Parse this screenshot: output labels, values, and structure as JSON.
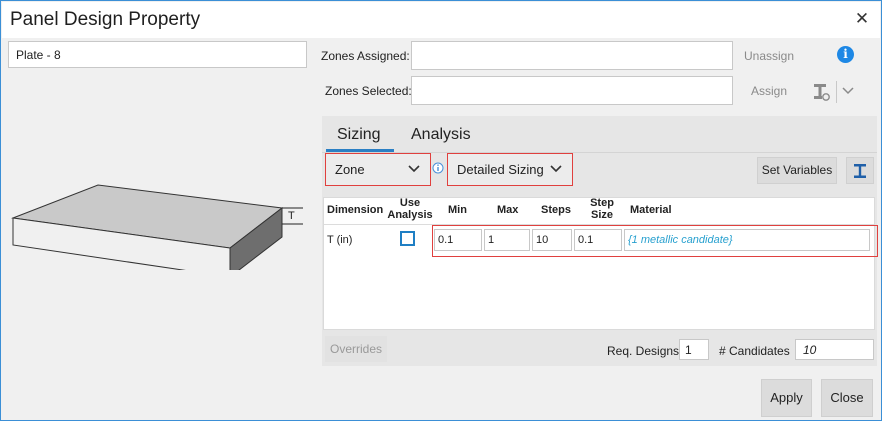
{
  "window": {
    "title": "Panel Design Property"
  },
  "left": {
    "name_value": "Plate - 8",
    "dimension_tag": "T"
  },
  "zones": {
    "assigned_label": "Zones Assigned:",
    "selected_label": "Zones Selected:",
    "assigned_value": "",
    "selected_value": "",
    "unassign_label": "Unassign",
    "assign_label": "Assign",
    "info_glyph": "i"
  },
  "tabs": [
    {
      "label": "Sizing"
    },
    {
      "label": "Analysis"
    }
  ],
  "sizing": {
    "scope_dropdown": "Zone",
    "method_dropdown": "Detailed Sizing",
    "set_variables_label": "Set Variables",
    "columns": {
      "dimension": "Dimension",
      "use_analysis_1": "Use",
      "use_analysis_2": "Analysis",
      "min": "Min",
      "max": "Max",
      "steps": "Steps",
      "step_size_1": "Step",
      "step_size_2": "Size",
      "material": "Material"
    },
    "row": {
      "dimension": "T (in)",
      "use_analysis": false,
      "min": "0.1",
      "max": "1",
      "steps": "10",
      "step_size": "0.1",
      "material": "{1 metallic candidate}"
    },
    "overrides_label": "Overrides",
    "req_designs_label": "Req. Designs",
    "req_designs_value": "1",
    "candidates_label": "# Candidates",
    "candidates_value": "10"
  },
  "footer": {
    "apply_label": "Apply",
    "close_label": "Close"
  },
  "colors": {
    "accent": "#2a7fc4",
    "highlight": "#e0403e",
    "link": "#27a0cf"
  }
}
